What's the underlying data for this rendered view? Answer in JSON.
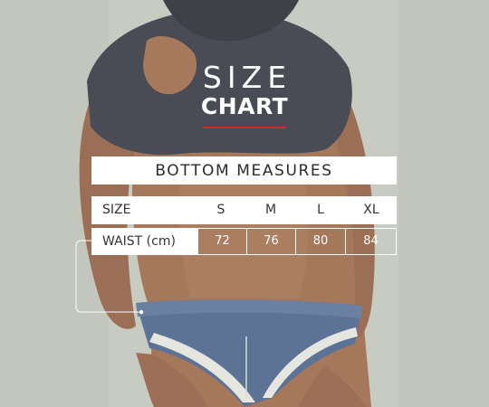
{
  "title": {
    "line1": "SIZE",
    "line2": "CHART",
    "accent_color": "#d8262e"
  },
  "banner": {
    "label": "BOTTOM MEASURES"
  },
  "table": {
    "header": {
      "label": "SIZE",
      "sizes": [
        "S",
        "M",
        "L",
        "XL"
      ]
    },
    "rows": [
      {
        "label": "WAIST (cm)",
        "values": [
          "72",
          "76",
          "80",
          "84"
        ]
      }
    ]
  }
}
